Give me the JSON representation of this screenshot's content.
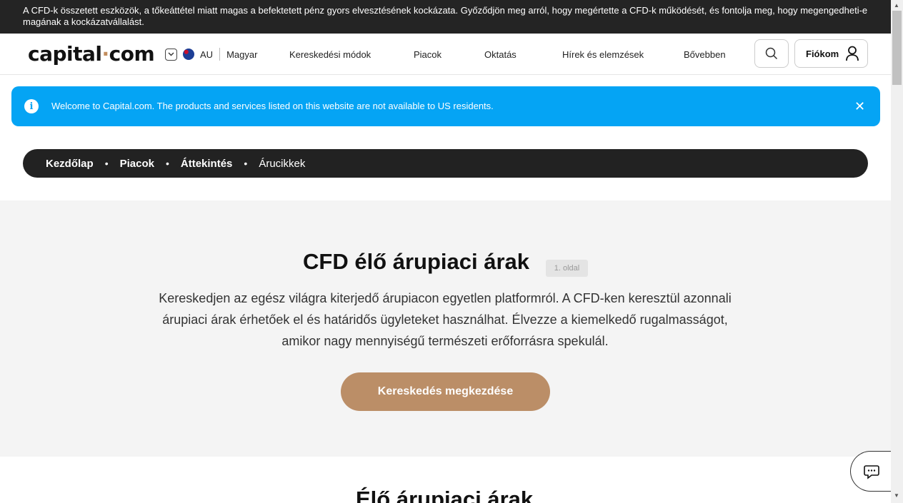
{
  "risk_warning": "A CFD-k összetett eszközök, a tőkeáttétel miatt magas a befektetett pénz gyors elvesztésének kockázata. Győződjön meg arról, hogy megértette a CFD-k működését, és fontolja meg, hogy megengedheti-e magának a kockázatvállalást.",
  "header": {
    "logo_left": "capital",
    "logo_dot": "·",
    "logo_right": "com",
    "region_code": "AU",
    "language": "Magyar",
    "nav": [
      "Kereskedési módok",
      "Piacok",
      "Oktatás",
      "Hírek és elemzések",
      "Bővebben"
    ],
    "account_label": "Fiókom"
  },
  "notice": {
    "message": "Welcome to Capital.com. The products and services listed on this website are not available to US residents.",
    "close_glyph": "✕"
  },
  "breadcrumb": [
    "Kezdőlap",
    "Piacok",
    "Áttekintés",
    "Árucikkek"
  ],
  "hero": {
    "title": "CFD élő árupiaci árak",
    "page_badge": "1. oldal",
    "description_lines": [
      "Kereskedjen az egész világra kiterjedő árupiacon egyetlen platformról. A CFD-ken keresztül azonnali",
      "árupiaci árak érhetőek el és határidős ügyleteket használhat. Élvezze a kiemelkedő rugalmasságot,",
      "amikor nagy mennyiségű természeti erőforrásra spekulál."
    ],
    "cta_label": "Kereskedés megkezdése"
  },
  "section_title": "Élő árupiaci árak",
  "colors": {
    "notice_blue": "#05a4f4",
    "cta_brown": "#bb8e67",
    "dark": "#222222"
  },
  "icons": [
    "chevron-down-icon",
    "australia-flag-icon",
    "search-icon",
    "user-icon",
    "info-icon",
    "close-icon",
    "chat-icon"
  ]
}
